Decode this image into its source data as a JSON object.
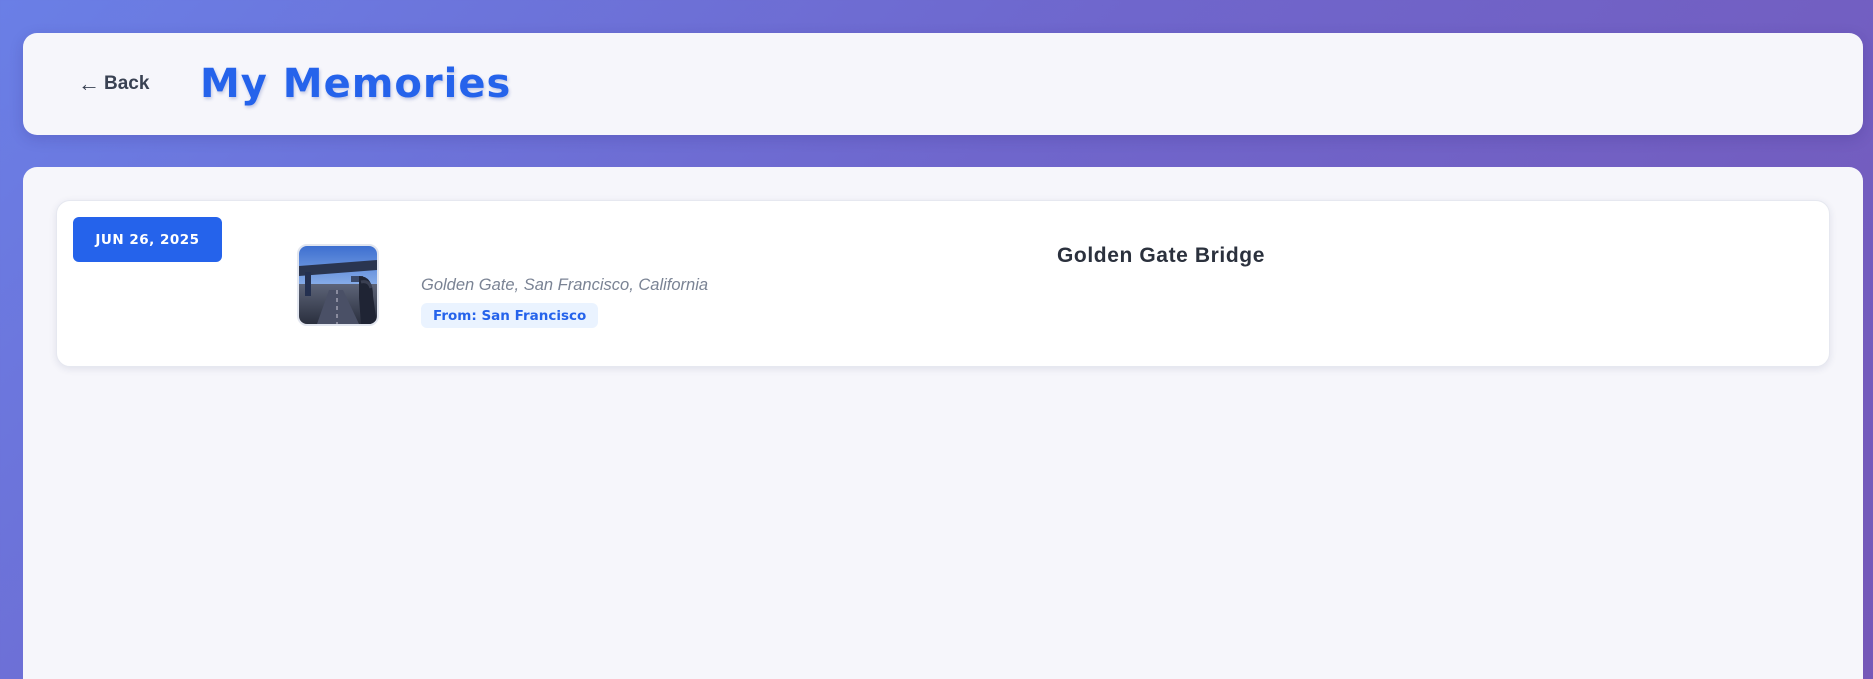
{
  "header": {
    "back_label": "Back",
    "back_icon": "left-arrow-icon",
    "title": "My Memories"
  },
  "memories": [
    {
      "date": "JUN 26, 2025",
      "thumbnail": "bridge-photo",
      "title": "Golden Gate Bridge",
      "address": "Golden Gate, San Francisco, California",
      "from_label": "From: San Francisco"
    }
  ],
  "colors": {
    "accent": "#2563eb",
    "background_start": "#6a7fe6",
    "background_end": "#7558b8",
    "card": "#ffffff",
    "panel": "#f6f6fb"
  }
}
